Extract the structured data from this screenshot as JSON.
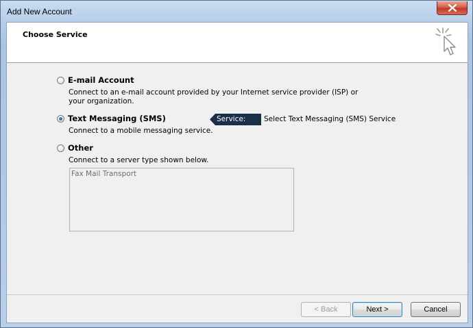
{
  "window": {
    "title": "Add New Account"
  },
  "header": {
    "title": "Choose Service",
    "icon": "wizard-cursor-icon"
  },
  "options": [
    {
      "label": "E-mail Account",
      "description_line1": "Connect to an e-mail account provided by your Internet service provider (ISP) or",
      "description_line2": "your organization.",
      "checked": false
    },
    {
      "label": "Text Messaging (SMS)",
      "description_line1": "Connect to a mobile messaging service.",
      "checked": true
    },
    {
      "label": "Other",
      "description_line1": "Connect to a server type shown below.",
      "checked": false
    }
  ],
  "service": {
    "tag_label": "Service:",
    "value": "Select Text Messaging (SMS) Service"
  },
  "server_types": [
    "Fax Mail Transport"
  ],
  "buttons": {
    "back": "< Back",
    "next": "Next >",
    "cancel": "Cancel"
  },
  "colors": {
    "service_tag": "#1c2f48",
    "close_button": "#c0392b"
  }
}
